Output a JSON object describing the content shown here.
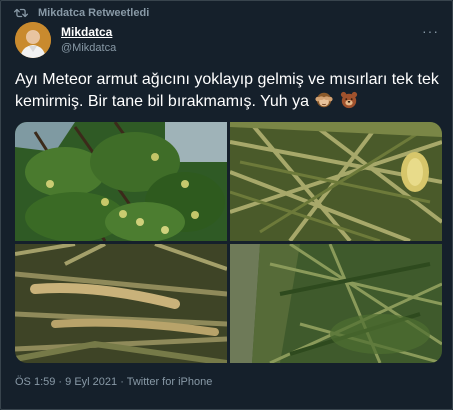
{
  "retweet": {
    "label": "Mikdatca Retweetledi",
    "icon": "retweet-icon"
  },
  "author": {
    "display_name": "Mikdatca",
    "handle": "@Mikdatca"
  },
  "tweet": {
    "text": "Ayı Meteor armut ağıcını yoklayıp gelmiş ve mısırları tek tek kemirmiş. Bir tane bil bırakmamış. Yuh ya",
    "emojis": [
      "see-no-evil-monkey",
      "bear-face"
    ]
  },
  "media": {
    "photos": [
      {
        "name": "pear-tree"
      },
      {
        "name": "damaged-corn-stalks"
      },
      {
        "name": "chewed-corn-cobs"
      },
      {
        "name": "trampled-corn-field"
      }
    ]
  },
  "meta": {
    "time": "ÖS 1:59",
    "date": "9 Eyl 2021",
    "separator": "·",
    "source": "Twitter for iPhone"
  },
  "colors": {
    "background": "#15202b",
    "secondary_text": "#8899a6",
    "border": "#38444d"
  }
}
